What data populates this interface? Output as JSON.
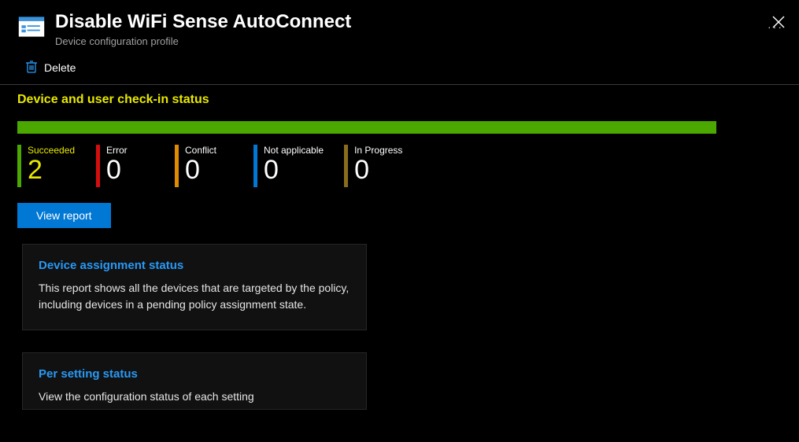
{
  "header": {
    "title": "Disable WiFi Sense AutoConnect",
    "subtitle": "Device configuration profile"
  },
  "toolbar": {
    "delete_label": "Delete"
  },
  "status": {
    "section_title": "Device and user check-in status",
    "stats": {
      "succeeded": {
        "label": "Succeeded",
        "value": "2"
      },
      "error": {
        "label": "Error",
        "value": "0"
      },
      "conflict": {
        "label": "Conflict",
        "value": "0"
      },
      "na": {
        "label": "Not applicable",
        "value": "0"
      },
      "inprogress": {
        "label": "In Progress",
        "value": "0"
      }
    },
    "view_report_label": "View report"
  },
  "cards": {
    "device_assignment": {
      "title": "Device assignment status",
      "desc": "This report shows all the devices that are targeted by the policy, including devices in a pending policy assignment state."
    },
    "per_setting": {
      "title": "Per setting status",
      "desc": "View the configuration status of each setting"
    }
  }
}
